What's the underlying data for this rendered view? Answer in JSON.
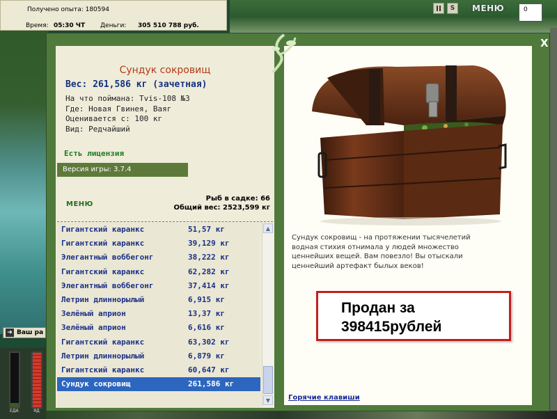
{
  "hud": {
    "experience_label": "Получено опыта: 180594",
    "time_label": "Время:",
    "time_value": "05:30 ЧТ",
    "money_label": "Деньги:",
    "money_value": "305 510 788 руб.",
    "pause_icon": "pause-icon",
    "s_button": "S",
    "top_menu_label": "МЕНЮ",
    "corner_value": "0",
    "bottom_button_label": "Ваш ра",
    "gauge_labels": [
      "ЕДА",
      "ЯД"
    ]
  },
  "dialog": {
    "close_label": "X",
    "fish_name": "Сундук сокровищ",
    "weight_line": "Вес: 261,586 кг (зачетная)",
    "caught_on": "На что поймана: Tvis-108 №3",
    "location": "Где: Новая Гвинея, Ваяг",
    "rated_from": "Оценивается с: 100 кг",
    "kind": "Вид: Редчайший",
    "license": "Есть лицензия",
    "version": "Версия игры: 3.7.4",
    "menu_label": "МЕНЮ",
    "fish_in_keepnet": "Рыб в садке: 66",
    "total_weight": "Общий вес: 2523,599 кг",
    "catch_list": [
      {
        "name": "Гигантский каранкс",
        "weight": "51,57 кг"
      },
      {
        "name": "Гигантский каранкс",
        "weight": "39,129 кг"
      },
      {
        "name": "Элегантный воббегонг",
        "weight": "38,222 кг"
      },
      {
        "name": "Гигантский каранкс",
        "weight": "62,282 кг"
      },
      {
        "name": "Элегантный воббегонг",
        "weight": "37,414 кг"
      },
      {
        "name": "Летрин длиннорылый",
        "weight": "6,915 кг"
      },
      {
        "name": "Зелёный априон",
        "weight": "13,37 кг"
      },
      {
        "name": "Зелёный априон",
        "weight": "6,616 кг"
      },
      {
        "name": "Гигантский каранкс",
        "weight": "63,302 кг"
      },
      {
        "name": "Летрин длиннорылый",
        "weight": "6,879 кг"
      },
      {
        "name": "Гигантский каранкс",
        "weight": "60,647 кг"
      },
      {
        "name": "Сундук сокровищ",
        "weight": "261,586 кг",
        "selected": true
      }
    ],
    "description_lines": [
      "Сундук сокровищ - на протяжении тысячелетий",
      "водная стихия отнимала у людей множество",
      "ценнейших вещей. Вам повезло! Вы отыскали",
      "ценнейший артефакт былых веков!"
    ],
    "sold_line1": "Продан за",
    "sold_line2": "398415рублей",
    "hotkeys_label": "Горячие клавиши"
  },
  "colors": {
    "dialog_bg": "#4f7a3c",
    "title_red": "#b33a16",
    "list_blue": "#1b3088",
    "selected_row": "#2c66bf",
    "license_green": "#1f7a22",
    "sold_border": "#c41e1e"
  }
}
